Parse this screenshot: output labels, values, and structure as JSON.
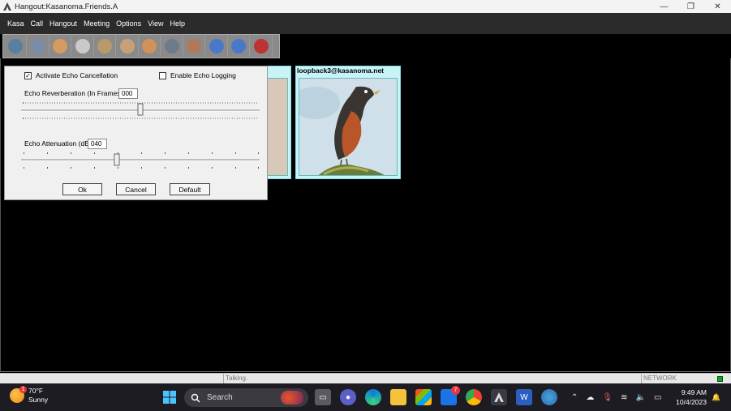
{
  "window": {
    "title": "Hangout:Kasanoma.Friends.A",
    "controls": [
      "—",
      "❐",
      "✕"
    ]
  },
  "menu": [
    "Kasa",
    "Call",
    "Hangout",
    "Meeting",
    "Options",
    "View",
    "Help"
  ],
  "toolbar": {
    "buttons": [
      {
        "icon": "globe-icon",
        "color": "#5a7ea0"
      },
      {
        "icon": "checkmark-icon",
        "color": "#7a8ca8"
      },
      {
        "icon": "user-icon",
        "color": "#d49a62"
      },
      {
        "icon": "document-icon",
        "color": "#c9c9c9"
      },
      {
        "icon": "user-add-icon",
        "color": "#b89a6a"
      },
      {
        "icon": "users-icon",
        "color": "#c8a078"
      },
      {
        "icon": "person-icon",
        "color": "#d2905a"
      },
      {
        "icon": "person-dark-icon",
        "color": "#6d7a8a"
      },
      {
        "icon": "box-icon",
        "color": "#b07a5a"
      },
      {
        "icon": "arrow-right-icon",
        "color": "#4a78c8"
      },
      {
        "icon": "arrow-left-icon",
        "color": "#4a78c8"
      },
      {
        "icon": "help-icon",
        "color": "#b33"
      }
    ]
  },
  "tiles": [
    {
      "label": "loopback3@kasanoma.net"
    }
  ],
  "dialog": {
    "activate_echo_cancellation": {
      "label": "Activate Echo Cancellation",
      "checked": true
    },
    "enable_echo_logging": {
      "label": "Enable Echo Logging",
      "checked": false
    },
    "reverberation": {
      "label": "Echo Reverberation (In Frames)",
      "value": "000",
      "level": 0.5
    },
    "attenuation": {
      "label": "Echo Attenuation (dB)",
      "value": "040",
      "level": 0.4
    },
    "buttons": {
      "ok": "Ok",
      "cancel": "Cancel",
      "default": "Default"
    }
  },
  "status": {
    "state": "Talking.",
    "network": "NETWORK",
    "indicator_color": "#1a9e2c"
  },
  "taskbar": {
    "weather": {
      "temp": "70°F",
      "condition": "Sunny",
      "badge": "1"
    },
    "search_label": "Search",
    "mail_badge": "7",
    "time": "9:49 AM",
    "date": "10/4/2023"
  }
}
